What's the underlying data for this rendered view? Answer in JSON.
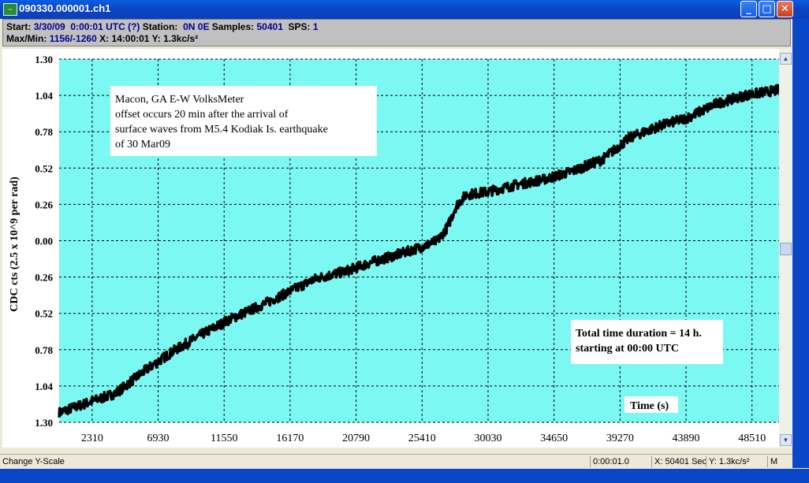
{
  "window": {
    "title": "090330.000001.ch1",
    "minimize_icon": "minimize-icon",
    "maximize_icon": "maximize-icon",
    "close_icon": "close-icon"
  },
  "info": {
    "start_label": "Start:",
    "start_value": "3/30/09  0:00:01 UTC (?)",
    "station_label": "Station:",
    "station_value": "0N 0E",
    "samples_label": "Samples:",
    "samples_value": "50401",
    "sps_label": "SPS:",
    "sps_value": "1",
    "maxmin_label": "Max/Min:",
    "maxmin_value": "1156/-1260",
    "x_label": "X:",
    "x_value": "14:00:01",
    "y_label": "Y:",
    "y_value": "1.3kc/s²"
  },
  "plot": {
    "background": "#7cf8f2",
    "trace_color": "#000000"
  },
  "annotations": {
    "top_left": [
      "Macon, GA E-W VolksMeter",
      "offset occurs 20 min after the arrival of",
      "surface waves from M5.4 Kodiak Is. earthquake",
      "of 30 Mar09"
    ],
    "bottom_right": [
      "Total time duration = 14 h.",
      "starting at 00:00 UTC"
    ]
  },
  "status": {
    "left": "Change Y-Scale",
    "time": "0:00:01.0",
    "x": "X: 50401 Sec",
    "y": "Y: 1.3kc/s²",
    "mode": "M"
  },
  "chart_data": {
    "type": "line",
    "ylabel": "CDC cts (2.5 x 10^9 per rad)",
    "xlabel": "Time  (s)",
    "x_ticks": [
      "2310",
      "6930",
      "11550",
      "16170",
      "20790",
      "25410",
      "30030",
      "34650",
      "39270",
      "43890",
      "48510"
    ],
    "y_ticks": [
      "1.30",
      "1.04",
      "0.78",
      "0.52",
      "0.26",
      "0.00",
      "0.26",
      "0.52",
      "0.78",
      "1.04",
      "1.30"
    ],
    "xlim": [
      0,
      50401
    ],
    "ylim": [
      -1.3,
      1.3
    ],
    "grid": true,
    "series": [
      {
        "x": [
          0,
          2000,
          4000,
          6000,
          8000,
          10000,
          12000,
          14000,
          16000,
          18000,
          20000,
          22000,
          24000,
          25500,
          26500,
          27200,
          27800,
          28500,
          30000,
          32000,
          34000,
          36000,
          38000,
          40000,
          42000,
          44000,
          46000,
          48000,
          50401
        ],
        "y": [
          -1.23,
          -1.16,
          -1.09,
          -0.93,
          -0.79,
          -0.67,
          -0.56,
          -0.47,
          -0.37,
          -0.27,
          -0.22,
          -0.15,
          -0.09,
          -0.04,
          0.0,
          0.1,
          0.25,
          0.33,
          0.35,
          0.4,
          0.44,
          0.5,
          0.58,
          0.74,
          0.82,
          0.88,
          0.98,
          1.04,
          1.08
        ]
      }
    ]
  }
}
